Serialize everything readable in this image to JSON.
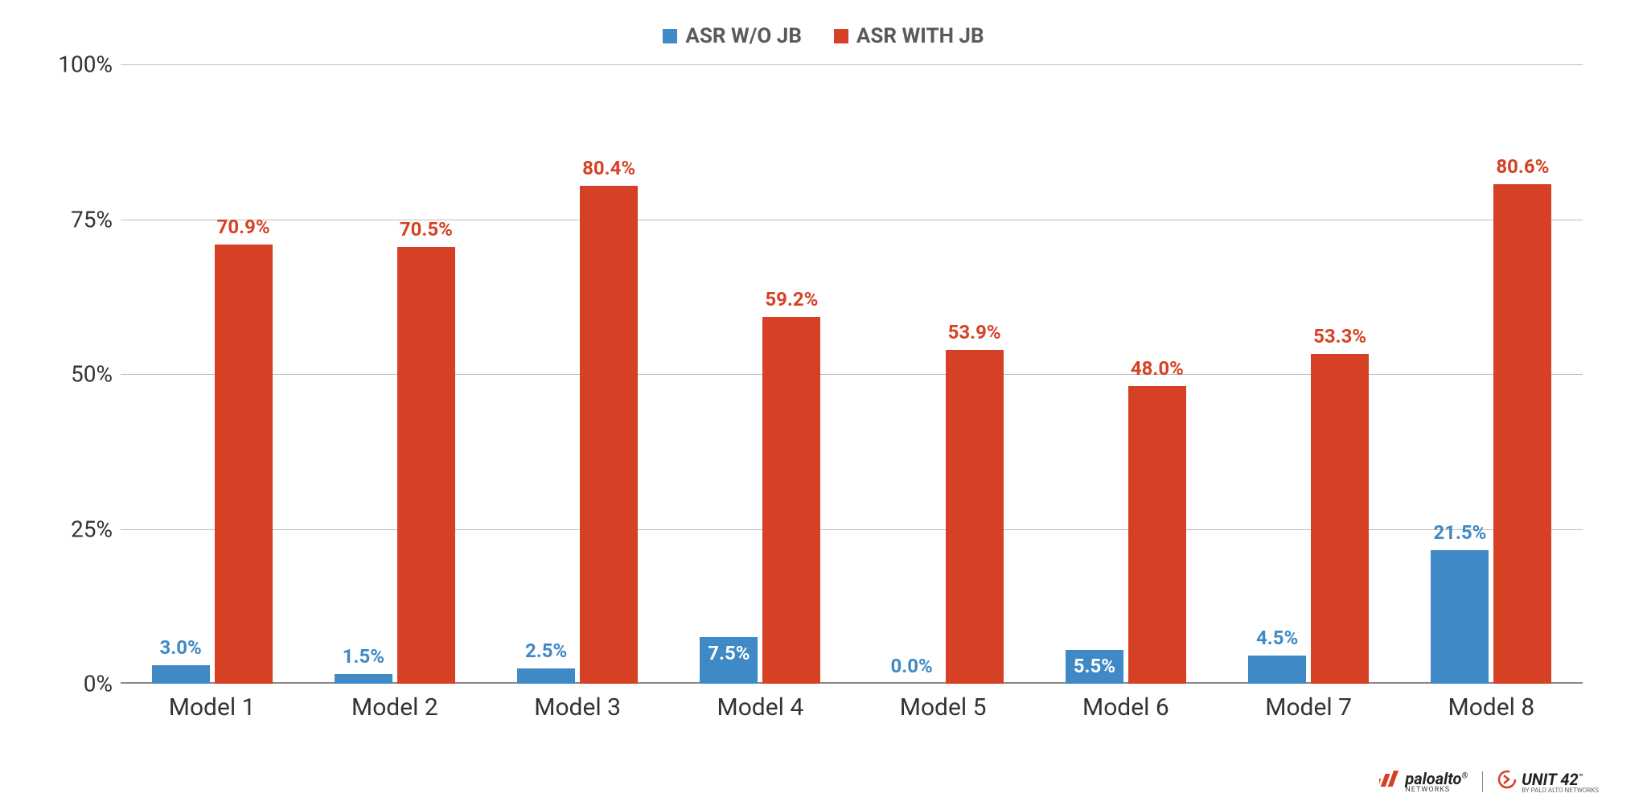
{
  "legend": {
    "series1": "ASR W/O JB",
    "series2": "ASR WITH JB"
  },
  "colors": {
    "series1": "#3E89C6",
    "series2": "#D64125"
  },
  "yticks": [
    "0%",
    "25%",
    "50%",
    "75%",
    "100%"
  ],
  "footer": {
    "brand1": "paloalto",
    "brand1_sub": "NETWORKS",
    "brand2": "UNIT 42",
    "brand2_sub": "BY PALO ALTO NETWORKS"
  },
  "chart_data": {
    "type": "bar",
    "title": "",
    "xlabel": "",
    "ylabel": "",
    "ylim": [
      0,
      100
    ],
    "categories": [
      "Model 1",
      "Model 2",
      "Model 3",
      "Model 4",
      "Model 5",
      "Model 6",
      "Model 7",
      "Model 8"
    ],
    "series": [
      {
        "name": "ASR W/O JB",
        "values": [
          3.0,
          1.5,
          2.5,
          7.5,
          0.0,
          5.5,
          4.5,
          21.5
        ]
      },
      {
        "name": "ASR WITH JB",
        "values": [
          70.9,
          70.5,
          80.4,
          59.2,
          53.9,
          48.0,
          53.3,
          80.6
        ]
      }
    ],
    "value_labels": [
      {
        "label_placement": [
          "above",
          "above",
          "above",
          "inside",
          "above",
          "inside",
          "above",
          "above"
        ]
      },
      {
        "label_placement": [
          "above",
          "above",
          "above",
          "above",
          "above",
          "above",
          "above",
          "above"
        ]
      }
    ]
  }
}
